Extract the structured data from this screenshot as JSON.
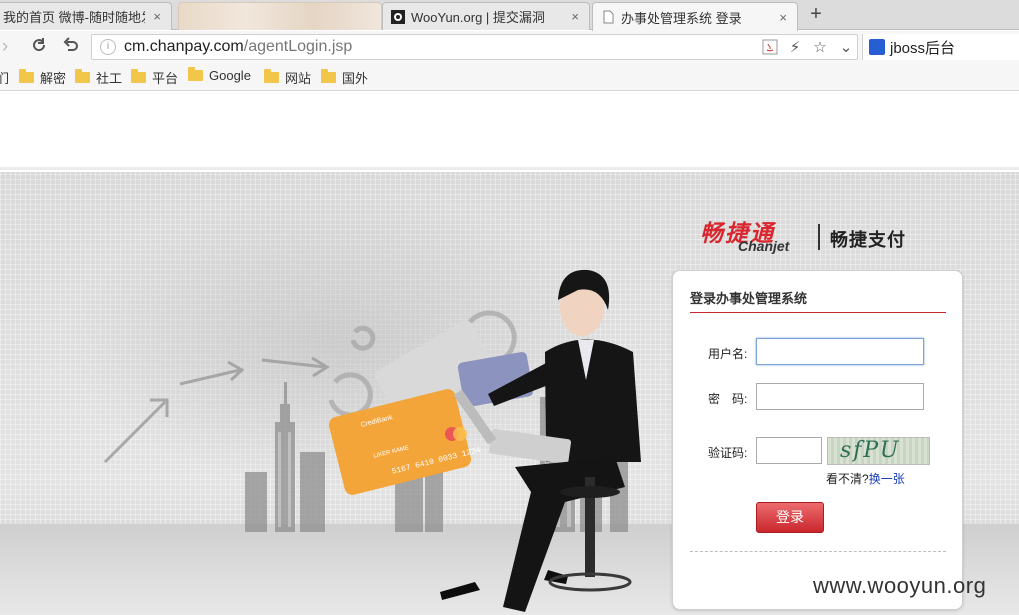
{
  "browser": {
    "tabs": [
      {
        "title": "我的首页 微博-随时随地发现",
        "close": "×"
      },
      {
        "title": "",
        "close": ""
      },
      {
        "title": "WooYun.org | 提交漏洞",
        "close": "×"
      },
      {
        "title": "办事处管理系统 登录",
        "close": "×"
      }
    ],
    "new_tab": "+",
    "address": {
      "host": "cm.chanpay.com",
      "path": "/agentLogin.jsp"
    },
    "extension_label": "jboss后台",
    "bookmarks": [
      "解密",
      "社工",
      "平台",
      "Google",
      "网站",
      "国外"
    ],
    "bookmark_edge": "们"
  },
  "page": {
    "logo_cn": "畅捷通",
    "logo_en": "Chanjet",
    "logo_sub": "畅捷支付",
    "panel_title": "登录办事处管理系统",
    "form": {
      "username_label": "用户名:",
      "password_label": "密　码:",
      "captcha_label": "验证码:",
      "captcha_text": "sfPU",
      "unclear_text": "看不清?",
      "refresh_link": "换一张",
      "submit": "登录"
    },
    "card_text": {
      "bank": "CrediBank",
      "holder": "LIKER KAME",
      "number": "5167 6410 0033 1234"
    },
    "watermark": "www.wooyun.org"
  },
  "colors": {
    "brand_red": "#d9262f",
    "button_red": "#c9272d",
    "link_blue": "#1a3fb8"
  }
}
